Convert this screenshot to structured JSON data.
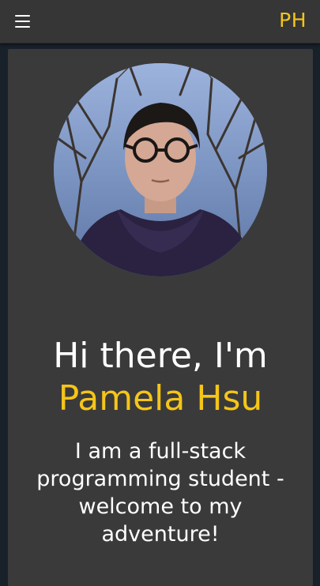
{
  "nav": {
    "menu_icon": "hamburger-menu-icon",
    "logo_text": "PH",
    "logo_color": "#f5c518"
  },
  "hero": {
    "avatar_alt": "Pamela Hsu portrait",
    "greeting": "Hi there, I'm",
    "name": "Pamela Hsu",
    "tagline": "I am a full-stack programming student - welcome to my adventure!"
  },
  "colors": {
    "page_bg": "#18202a",
    "navbar_bg": "#363636",
    "card_bg": "#3a3a3a",
    "accent": "#f5c518",
    "text": "#ffffff"
  }
}
